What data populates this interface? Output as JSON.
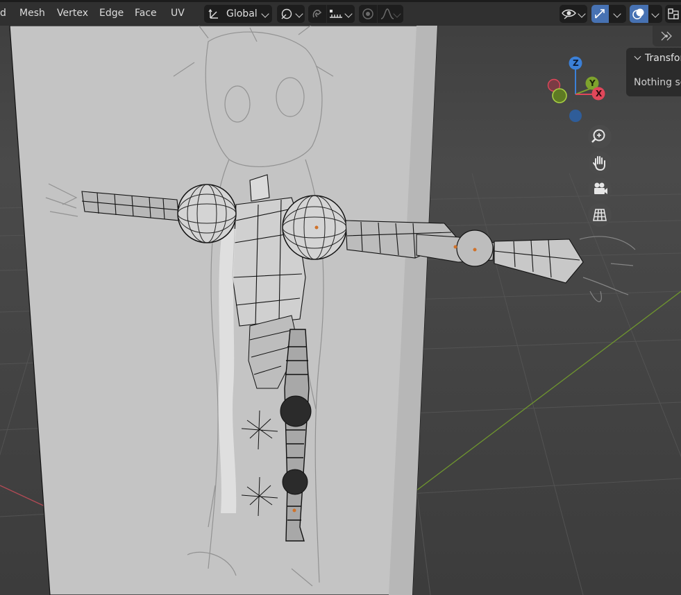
{
  "header": {
    "menu": [
      {
        "label": "d"
      },
      {
        "label": "Mesh"
      },
      {
        "label": "Vertex"
      },
      {
        "label": "Edge"
      },
      {
        "label": "Face"
      },
      {
        "label": "UV"
      }
    ],
    "orientation": {
      "label": "Global"
    }
  },
  "gizmo": {
    "z": "Z",
    "y": "Y",
    "x": "X"
  },
  "panel": {
    "title": "Transform",
    "message": "Nothing selected"
  },
  "colors": {
    "x_axis": "#e0475a",
    "y_axis": "#7ea32d",
    "z_axis": "#3b80d8",
    "active_blue": "#4772b3"
  },
  "icons": [
    "transform-pivot-icon",
    "snap-icon",
    "proportional-edit-icon",
    "visibility-icon",
    "gizmo-icon",
    "overlay-icon",
    "xray-icon",
    "zoom-icon",
    "pan-hand-icon",
    "camera-icon",
    "grid-perspective-icon"
  ]
}
